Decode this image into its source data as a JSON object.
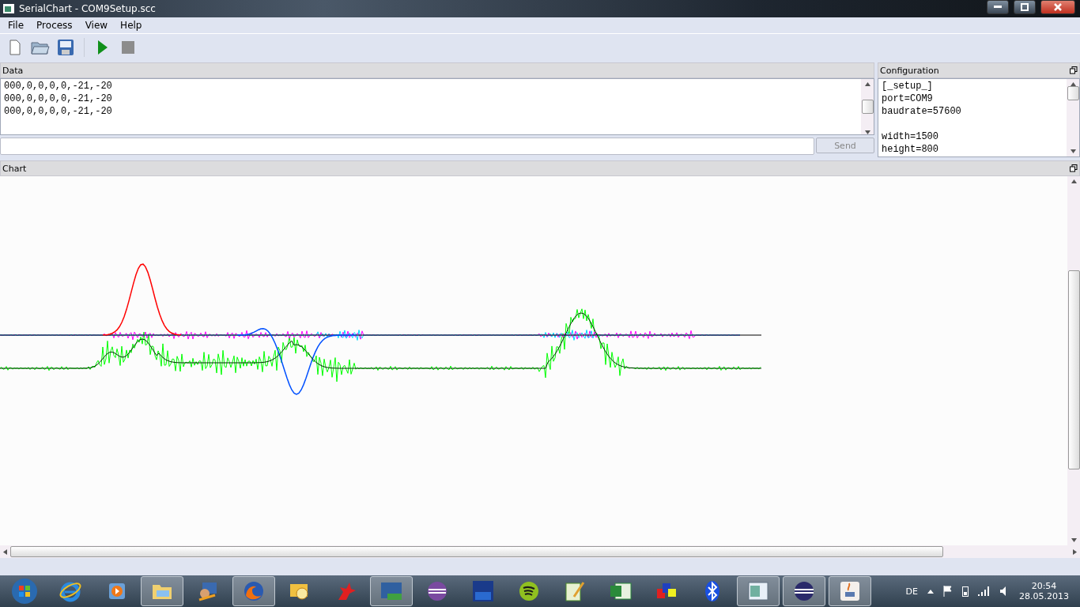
{
  "window": {
    "title": "SerialChart - COM9Setup.scc"
  },
  "menu": [
    "File",
    "Process",
    "View",
    "Help"
  ],
  "toolbar": [
    {
      "kind": "new"
    },
    {
      "kind": "open"
    },
    {
      "kind": "save"
    },
    {
      "kind": "run"
    },
    {
      "kind": "stop",
      "disabled": true
    }
  ],
  "data_panel": {
    "title": "Data",
    "lines": [
      "000,0,0,0,0,-21,-20",
      "000,0,0,0,0,-21,-20",
      "000,0,0,0,0,-21,-20"
    ],
    "send_button": {
      "label": "Send",
      "disabled": true
    }
  },
  "config_panel": {
    "title": "Configuration",
    "sections": [
      [
        "[_setup_]",
        "port=COM9",
        "baudrate=57600"
      ],
      [
        "width=1500",
        "height=800"
      ]
    ]
  },
  "chart_panel": {
    "title": "Chart"
  },
  "taskbar": {
    "apps": [
      {
        "kind": "ie",
        "running": false
      },
      {
        "kind": "media",
        "running": false
      },
      {
        "kind": "folder",
        "running": true
      },
      {
        "kind": "remote",
        "running": false
      },
      {
        "kind": "firefox",
        "running": true
      },
      {
        "kind": "mail",
        "running": false
      },
      {
        "kind": "bird",
        "running": false
      },
      {
        "kind": "utility",
        "running": true
      },
      {
        "kind": "sphere",
        "running": false
      },
      {
        "kind": "dev",
        "running": false
      },
      {
        "kind": "spotify",
        "running": false
      },
      {
        "kind": "notepad",
        "running": false
      },
      {
        "kind": "excel",
        "running": false
      },
      {
        "kind": "blocks",
        "running": false
      },
      {
        "kind": "bluetooth",
        "running": false
      },
      {
        "kind": "window",
        "running": true
      },
      {
        "kind": "eclipse",
        "running": true
      },
      {
        "kind": "java",
        "running": true
      }
    ],
    "language": "DE",
    "time": "20:54",
    "date": "28.05.2013"
  }
}
